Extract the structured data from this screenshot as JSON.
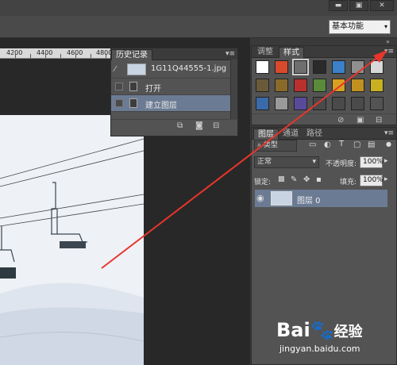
{
  "window_buttons": [
    "▬",
    "▣",
    "✕"
  ],
  "workspace": {
    "label": "基本功能",
    "arrow": "▾"
  },
  "ruler": {
    "ticks": [
      "4200",
      "4400",
      "4600",
      "4800"
    ]
  },
  "history": {
    "tab_label": "历史记录",
    "menu": "▾≡",
    "snapshot_label": "1G11Q44555-1.jpg",
    "items": [
      {
        "label": "打开",
        "selected": false
      },
      {
        "label": "建立图层",
        "selected": true
      }
    ],
    "footer_icons": [
      "new-document-icon",
      "camera-icon",
      "trash-icon"
    ]
  },
  "styles_panel": {
    "tabs": [
      "调整",
      "样式"
    ],
    "active_tab": "样式",
    "menu": "▾≡",
    "swatch_colors": [
      [
        "#ffffff",
        "#d84a2c",
        "#6e6e6e",
        "#2a2a2a",
        "#3b80c8",
        "#8f8f8f",
        "#d8d8d8"
      ],
      [
        "#6b5a3a",
        "#8a6a2a",
        "#b83030",
        "#5a8a3a",
        "#d8a020",
        "#c09020",
        "#c8b020"
      ],
      [
        "#3a6aa8",
        "#9a9a9a",
        "#5a4a9a",
        "#4a4a4a",
        "#4a4a4a",
        "#4a4a4a",
        "#535353"
      ]
    ],
    "footer_icons": [
      "no-style-icon",
      "new-style-icon",
      "trash-icon"
    ]
  },
  "layers_panel": {
    "tabs": [
      "图层",
      "通道",
      "路径"
    ],
    "active_tab": "图层",
    "kind_filter": "类型",
    "blend_mode": "正常",
    "opacity_label": "不透明度:",
    "opacity_value": "100%",
    "lock_label": "锁定:",
    "fill_label": "填充:",
    "fill_value": "100%",
    "layer": {
      "name": "图层 0",
      "visible": true
    }
  },
  "watermark": {
    "brand": "Bai",
    "brand2": "经验",
    "url": "jingyan.baidu.com"
  }
}
